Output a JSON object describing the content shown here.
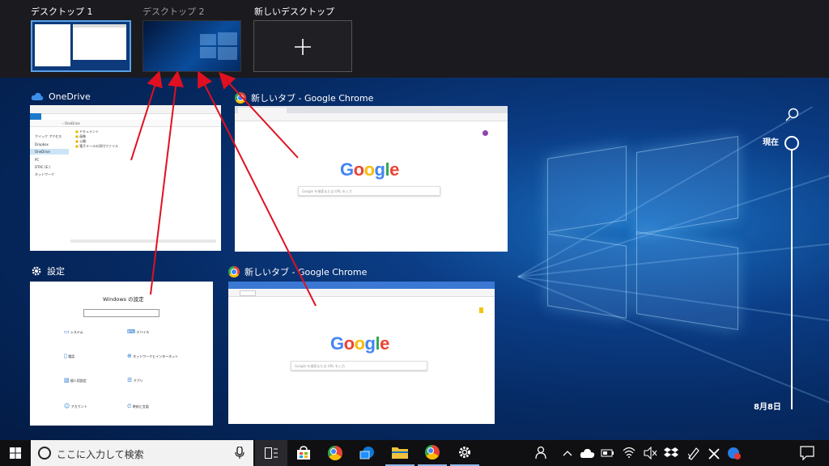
{
  "desktops": [
    {
      "label": "デスクトップ 1",
      "active": true
    },
    {
      "label": "デスクトップ 2",
      "active": false
    },
    {
      "label": "新しいデスクトップ",
      "new": true
    }
  ],
  "windows": {
    "onedrive": {
      "title": "OneDrive",
      "nav": [
        "クイック アクセス",
        "Dropbox",
        "OneDrive",
        "PC",
        "DTAC (E:)",
        "ネットワーク"
      ],
      "files": [
        "ドキュメント",
        "画像",
        "公開",
        "電子メールの添付ファイル"
      ]
    },
    "chrome1": {
      "title": "新しいタブ - Google Chrome",
      "search_placeholder": "Google を検索または URL を入力"
    },
    "settings": {
      "title": "設定",
      "heading": "Windows の設定",
      "items": [
        {
          "label": "システム",
          "icon": "display-icon"
        },
        {
          "label": "デバイス",
          "icon": "keyboard-icon"
        },
        {
          "label": "電話",
          "icon": "phone-icon"
        },
        {
          "label": "ネットワークとインターネット",
          "icon": "globe-icon"
        },
        {
          "label": "個人用設定",
          "icon": "brush-icon"
        },
        {
          "label": "アプリ",
          "icon": "apps-icon"
        },
        {
          "label": "アカウント",
          "icon": "person-icon"
        },
        {
          "label": "時刻と言語",
          "icon": "clock-icon"
        }
      ]
    },
    "chrome2": {
      "title": "新しいタブ - Google Chrome",
      "search_placeholder": "Google を検索または URL を入力"
    }
  },
  "google_logo": "Google",
  "timeline": {
    "now_label": "現在",
    "date_label": "8月8日"
  },
  "taskbar": {
    "search_placeholder": "ここに入力して検索"
  },
  "colors": {
    "arrow": "#e01020",
    "accent": "#3b78d4",
    "deskbar": "#1a1a1f",
    "taskbar": "#101012"
  }
}
